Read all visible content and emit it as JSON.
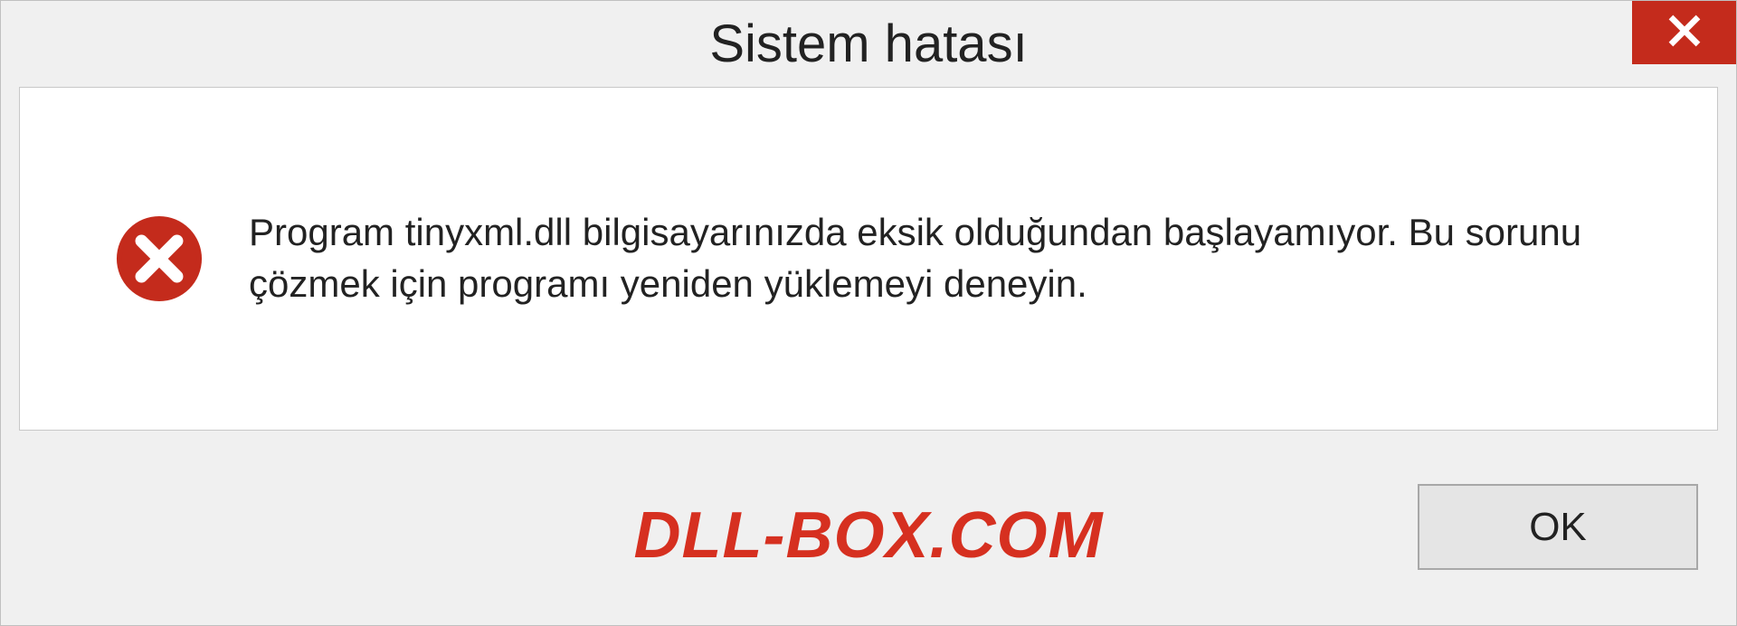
{
  "dialog": {
    "title": "Sistem hatası",
    "message": "Program tinyxml.dll bilgisayarınızda eksik olduğundan başlayamıyor. Bu sorunu çözmek için programı yeniden yüklemeyi deneyin.",
    "ok_label": "OK"
  },
  "watermark": "DLL-BOX.COM",
  "colors": {
    "close_button": "#c42b1c",
    "error_icon": "#c42b1c",
    "watermark": "#d63020"
  }
}
